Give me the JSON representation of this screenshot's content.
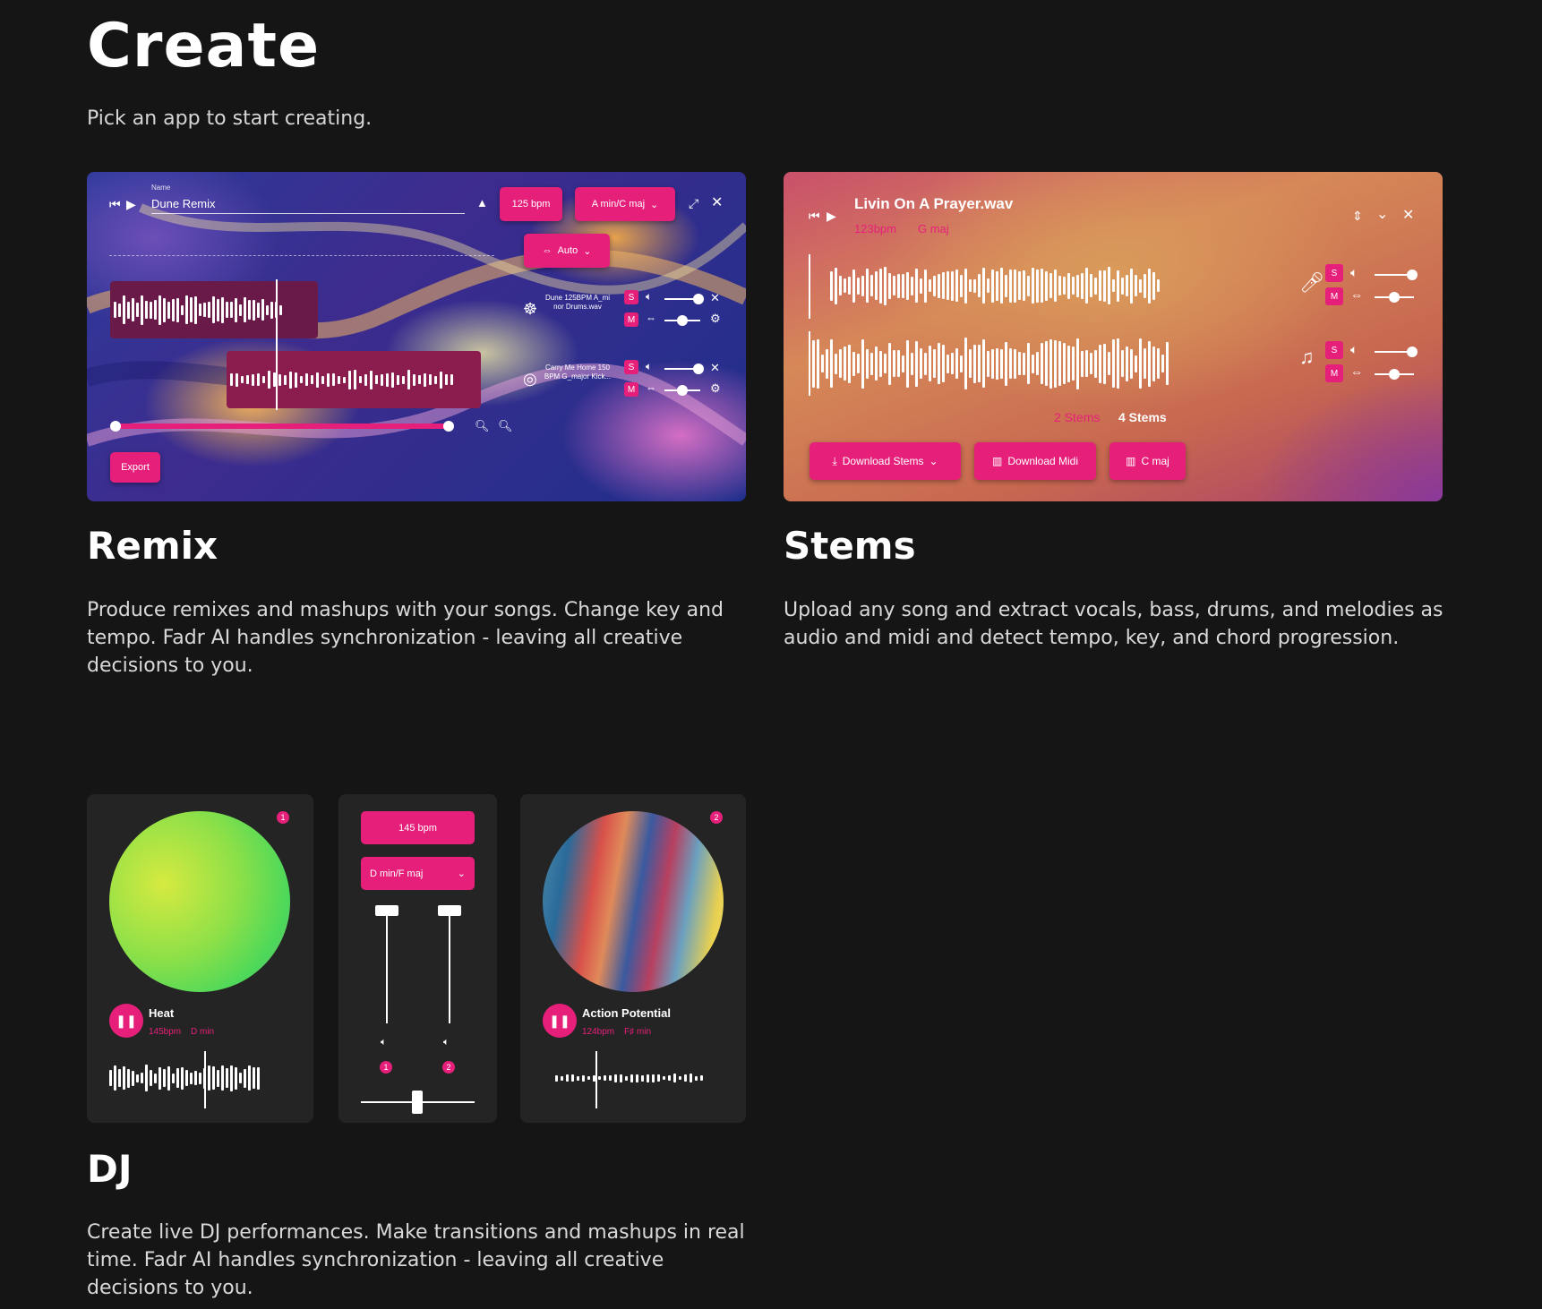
{
  "header": {
    "title": "Create",
    "subtitle": "Pick an app to start creating."
  },
  "remix": {
    "title": "Remix",
    "description": "Produce remixes and mashups with your songs. Change key and tempo. Fadr AI handles synchronization - leaving all creative decisions to you.",
    "name_label": "Name",
    "name_value": "Dune Remix",
    "bpm": "125 bpm",
    "key": "A min/C maj",
    "sync": "Auto",
    "export": "Export",
    "track1": "Dune 125BPM A_mi nor Drums.wav",
    "track2": "Carry Me Home 150 BPM G_major Kick..."
  },
  "stems": {
    "title": "Stems",
    "description": "Upload any song and extract vocals, bass, drums, and melodies as audio and midi and detect tempo, key, and chord progression.",
    "filename": "Livin On A Prayer.wav",
    "bpm": "123bpm",
    "key": "G maj",
    "stems_count_faded": "2 Stems",
    "stems_count": "4 Stems",
    "btn_download_stems": "Download Stems",
    "btn_download_midi": "Download Midi",
    "btn_key": "C maj",
    "solo": "S",
    "mute": "M"
  },
  "dj": {
    "title": "DJ",
    "description": "Create live DJ performances. Make transitions and mashups in real time. Fadr AI handles synchronization - leaving all creative decisions to you.",
    "deck1": {
      "name": "Heat",
      "bpm": "145bpm",
      "key": "D min",
      "num": "1"
    },
    "deck2": {
      "name": "Action Potential",
      "bpm": "124bpm",
      "key": "F♯ min",
      "num": "2"
    },
    "mixer_bpm": "145 bpm",
    "mixer_key": "D min/F maj",
    "ch1": "1",
    "ch2": "2"
  },
  "colors": {
    "accent": "#e6207a",
    "bg": "#151515",
    "card": "#242424"
  }
}
